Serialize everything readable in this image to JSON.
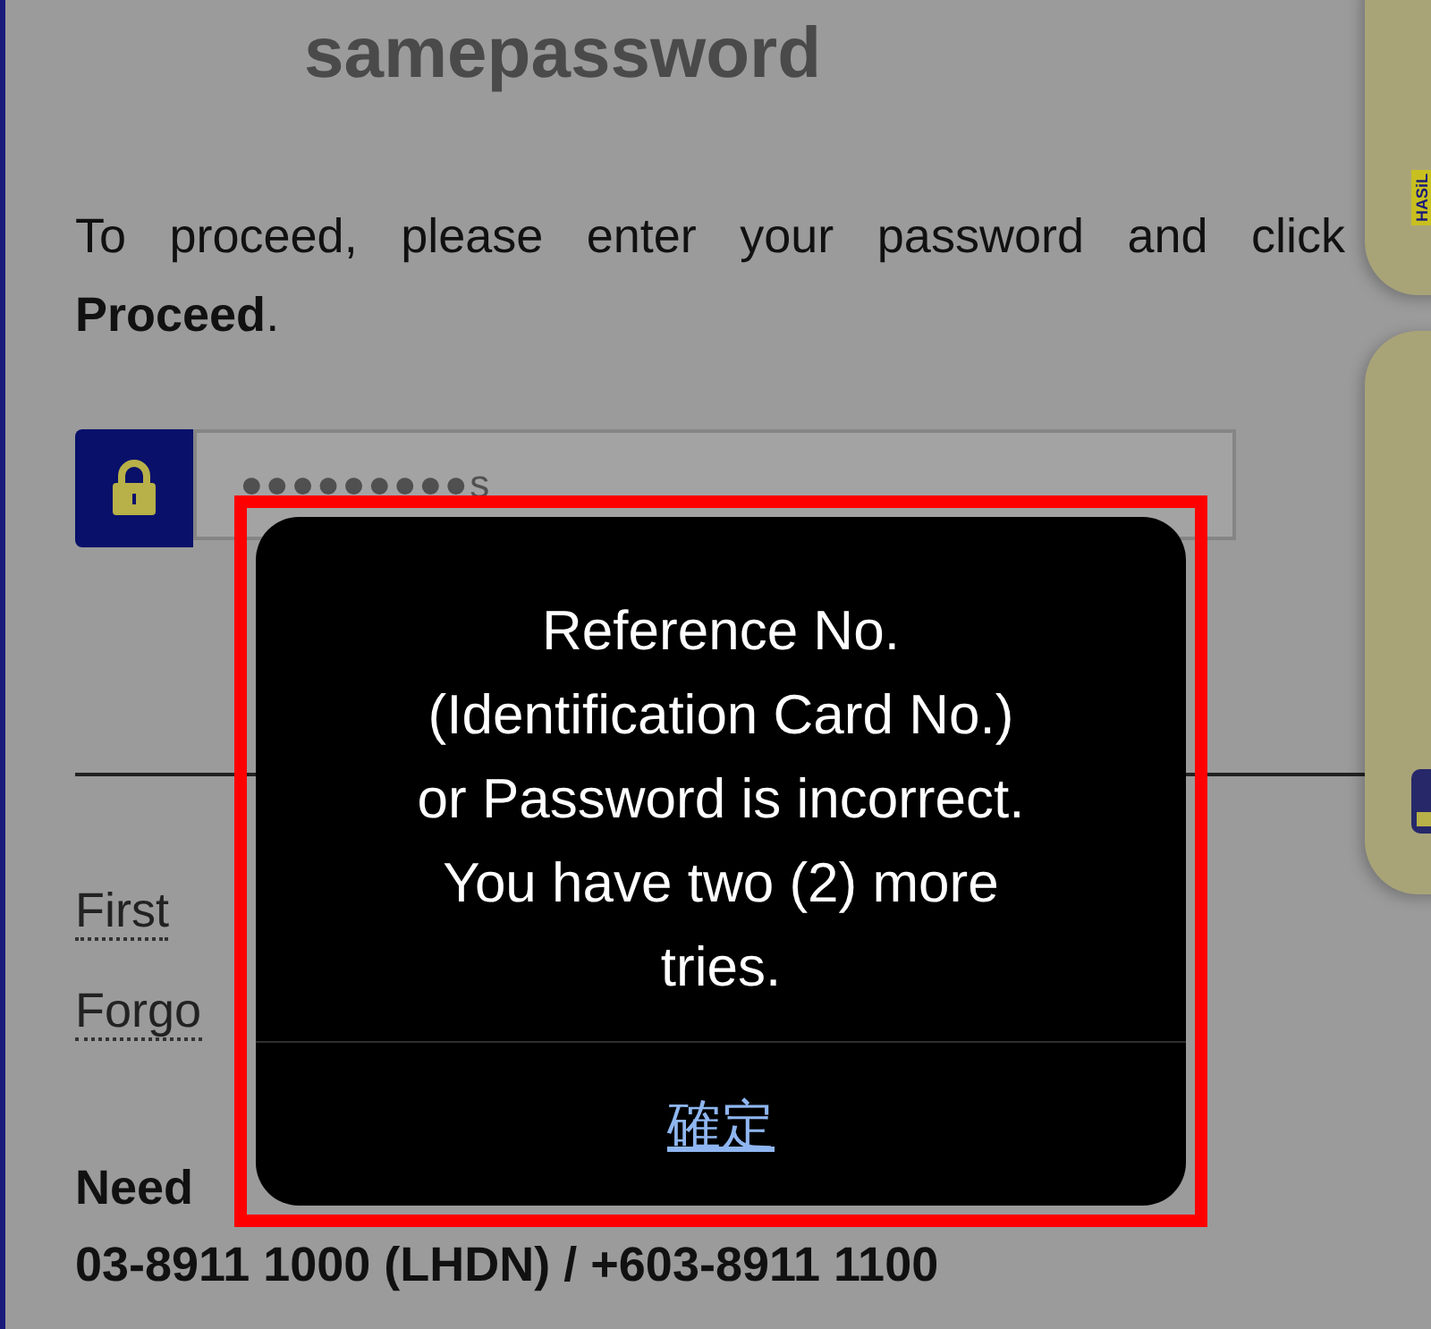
{
  "page": {
    "title": "samepassword",
    "instruction": "To proceed, please enter your password and click **Proceed**.",
    "password": {
      "value": "●●●●●●●●●s"
    },
    "links": [
      "First",
      "Forgo"
    ],
    "help_heading": "Need",
    "help_phone": "03-8911 1000 (LHDN) / +603-8911 1100"
  },
  "side_badge": "HASiL",
  "alert": {
    "message": "Reference No.\n(Identification Card No.)\nor Password is incorrect.\nYou have two (2) more\ntries.",
    "button": "確定"
  }
}
